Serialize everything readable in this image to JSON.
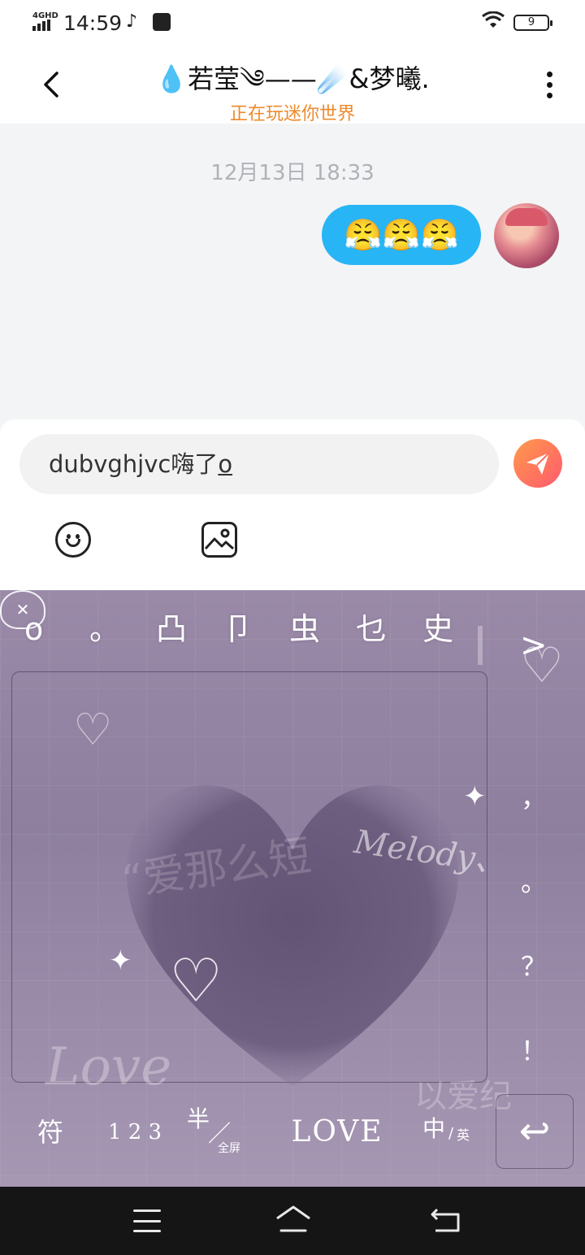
{
  "status_bar": {
    "network": "4GHD",
    "time": "14:59",
    "battery": "9",
    "icons": [
      "signal-icon",
      "tiktok-icon",
      "shopping-bag-icon",
      "wifi-icon",
      "battery-icon"
    ]
  },
  "header": {
    "title": "💧若莹༄——☄️&梦曦.",
    "subtitle": "正在玩迷你世界",
    "back_icon": "chevron-left-icon",
    "more_icon": "more-vertical-icon"
  },
  "chat": {
    "timestamp": "12月13日 18:33",
    "messages": [
      {
        "side": "right",
        "content": "😤😤😤",
        "bubble_color": "#27b5f5"
      }
    ]
  },
  "composer": {
    "input_text": "dubvghjvc嗨了",
    "composing_tail": "o",
    "send_icon": "send-icon",
    "send_gradient": [
      "#ff9a4a",
      "#ff5a6e"
    ],
    "tools": [
      "emoji-icon",
      "image-icon"
    ]
  },
  "keyboard": {
    "candidates": [
      "o",
      "。",
      "凸",
      "卩",
      "虫",
      "乜",
      "史"
    ],
    "expand": ">",
    "side_keys": [
      "，",
      "。",
      "？",
      "！"
    ],
    "decorations": {
      "melody": "Melody、",
      "love": "Love"
    },
    "bottom_keys": {
      "symbols": "符",
      "numbers": "1 2 3",
      "half_width": "半",
      "full_screen": "全屏",
      "love": "LOVE",
      "chinese": "中",
      "english": "英"
    },
    "enter_icon": "enter-icon"
  },
  "navbar": {
    "icons": [
      "menu-icon",
      "home-icon",
      "back-icon"
    ]
  }
}
